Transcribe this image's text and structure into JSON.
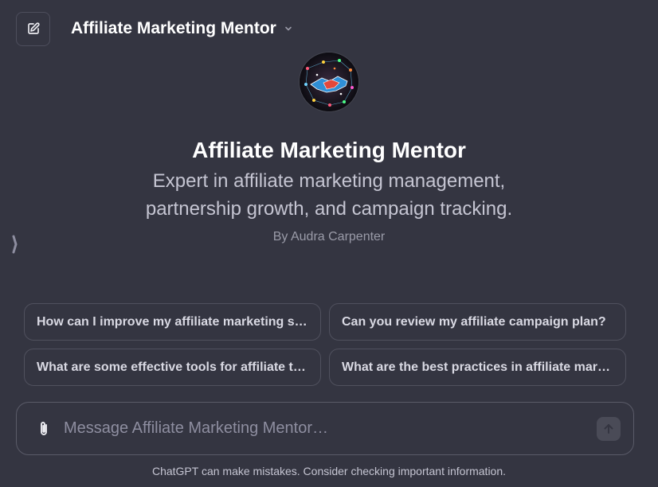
{
  "header": {
    "model_name": "Affiliate Marketing Mentor",
    "new_chat_icon": "edit-square-icon",
    "dropdown_icon": "chevron-down-icon"
  },
  "gpt": {
    "name": "Affiliate Marketing Mentor",
    "description": "Expert in affiliate marketing management, partnership growth, and campaign tracking.",
    "author": "By Audra Carpenter",
    "avatar_icon": "handshake-network-avatar"
  },
  "starters": [
    {
      "label": "How can I improve my affiliate marketing strategy?"
    },
    {
      "label": "Can you review my affiliate campaign plan?"
    },
    {
      "label": "What are some effective tools for affiliate tracking?"
    },
    {
      "label": "What are the best practices in affiliate marketing?"
    }
  ],
  "composer": {
    "placeholder": "Message Affiliate Marketing Mentor…",
    "attach_icon": "paperclip-icon",
    "send_icon": "arrow-up-icon"
  },
  "footer": {
    "disclaimer": "ChatGPT can make mistakes. Consider checking important information."
  },
  "colors": {
    "background": "#343541",
    "text_primary": "#ffffff",
    "text_secondary": "#c5c5d2",
    "border": "#50515e"
  }
}
